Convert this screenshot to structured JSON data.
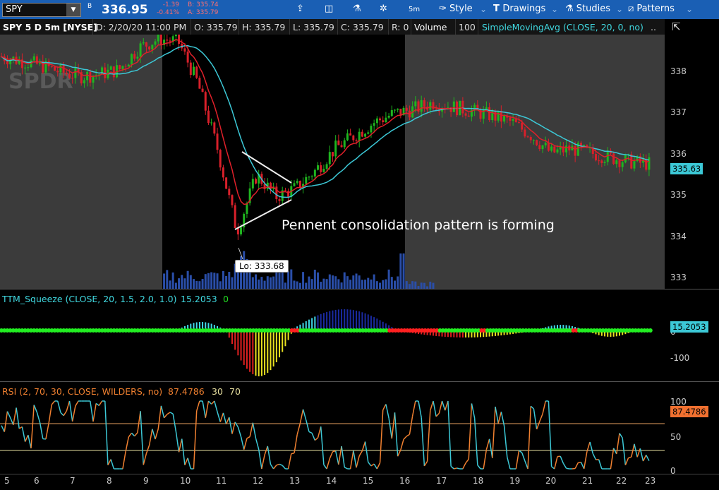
{
  "toolbar": {
    "symbol": "SPY",
    "b_marker": "B",
    "last_price": "336.95",
    "change": "-1.39",
    "change_pct": "-0.41%",
    "bid": "B: 335.74",
    "ask": "A: 335.79",
    "interval": "5m",
    "style": "Style",
    "drawings": "Drawings",
    "studies": "Studies",
    "patterns": "Patterns"
  },
  "header": {
    "title": "SPY 5 D 5m [NYSE]",
    "date": "D: 2/20/20 11:00 PM",
    "open": "O: 335.79",
    "high": "H: 335.79",
    "low": "L: 335.79",
    "close": "C: 335.79",
    "range": "R: 0",
    "volume_label": "Volume",
    "volume_value": "100",
    "sma": "SimpleMovingAvg (CLOSE, 20, 0, no)",
    "more": ".."
  },
  "price_axis": {
    "ticks": [
      "338",
      "337",
      "336",
      "335",
      "334",
      "333"
    ],
    "current_tag": "335.63"
  },
  "annotation": {
    "text": "Pennent consolidation pattern is forming",
    "low_label": "Lo: 333.68"
  },
  "squeeze": {
    "label": "TTM_Squeeze (CLOSE, 20, 1.5, 2.0, 1.0)",
    "value": "15.2053",
    "zero": "0",
    "ticks": [
      "0",
      "-100"
    ],
    "tag": "15.2053"
  },
  "rsi": {
    "label": "RSI (2, 70, 30, CLOSE, WILDERS, no)",
    "value": "87.4786",
    "oversold": "30",
    "overbought": "70",
    "ticks": [
      "100",
      "50",
      "0"
    ],
    "tag": "87.4786"
  },
  "time_axis": [
    "5",
    "6",
    "7",
    "8",
    "9",
    "10",
    "11",
    "12",
    "13",
    "14",
    "15",
    "16",
    "17",
    "18",
    "19",
    "20",
    "21",
    "22",
    "23"
  ],
  "chart_data": {
    "type": "line",
    "price_range": [
      332.8,
      338.6
    ],
    "session_close": [
      {
        "t": 0,
        "p": 338.1
      },
      {
        "t": 1,
        "p": 338.0
      },
      {
        "t": 2,
        "p": 337.9
      },
      {
        "t": 3,
        "p": 337.75
      },
      {
        "t": 4,
        "p": 337.65
      },
      {
        "t": 5,
        "p": 337.7
      },
      {
        "t": 6,
        "p": 337.8
      },
      {
        "t": 7,
        "p": 338.3
      },
      {
        "t": 8,
        "p": 338.5
      },
      {
        "t": 9,
        "p": 338.45
      },
      {
        "t": 10,
        "p": 337.5
      },
      {
        "t": 11,
        "p": 336.0
      },
      {
        "t": 12,
        "p": 334.1
      },
      {
        "t": 13,
        "p": 335.4
      },
      {
        "t": 14,
        "p": 334.9
      },
      {
        "t": 15,
        "p": 335.1
      },
      {
        "t": 16,
        "p": 335.5
      },
      {
        "t": 17,
        "p": 336.0
      },
      {
        "t": 18,
        "p": 336.3
      },
      {
        "t": 19,
        "p": 336.6
      },
      {
        "t": 20,
        "p": 336.8
      },
      {
        "t": 21,
        "p": 336.9
      },
      {
        "t": 22,
        "p": 337.05
      },
      {
        "t": 23,
        "p": 336.95
      },
      {
        "t": 24,
        "p": 336.85
      },
      {
        "t": 25,
        "p": 336.75
      },
      {
        "t": 26,
        "p": 336.6
      },
      {
        "t": 27,
        "p": 336.3
      },
      {
        "t": 28,
        "p": 335.9
      },
      {
        "t": 29,
        "p": 336.0
      },
      {
        "t": 30,
        "p": 335.9
      },
      {
        "t": 31,
        "p": 335.8
      },
      {
        "t": 32,
        "p": 335.7
      },
      {
        "t": 33,
        "p": 335.65
      }
    ]
  }
}
